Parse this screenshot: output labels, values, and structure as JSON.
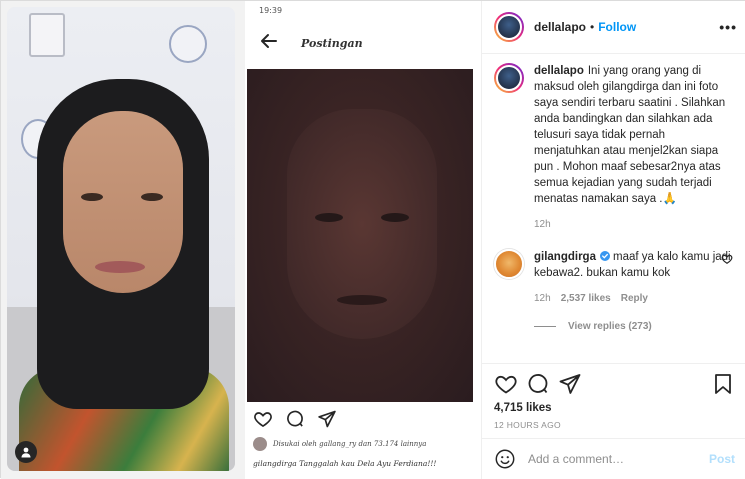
{
  "media": {
    "phone_status": "19:39",
    "phone_title": "Postingan",
    "phone_likes_text": "Disukai oleh gallang_ry dan 73.174 lainnya",
    "phone_caption": "gilangdirga Tanggalah kau Dela Ayu Ferdiana!!!"
  },
  "header": {
    "username": "dellalapo",
    "dot": "•",
    "follow_label": "Follow",
    "more_label": "•••"
  },
  "caption": {
    "username": "dellalapo",
    "text": "Ini yang orang yang di maksud oleh gilangdirga dan ini foto saya sendiri terbaru saatini . Silahkan anda bandingkan dan silahkan ada telusuri saya tidak pernah menjatuhkan atau menjel2kan siapa pun . Mohon maaf sebesar2nya atas semua kejadian yang sudah terjadi menatas namakan saya .🙏",
    "time": "12h"
  },
  "comment": {
    "username": "gilangdirga",
    "text": "maaf ya kalo kamu jadi kebawa2. bukan kamu kok",
    "time": "12h",
    "likes": "2,537 likes",
    "reply_label": "Reply",
    "view_replies": "View replies (273)"
  },
  "actions": {
    "likes": "4,715 likes",
    "time_ago": "12 HOURS AGO"
  },
  "add_comment": {
    "placeholder": "Add a comment…",
    "post_label": "Post"
  },
  "colors": {
    "link_blue": "#0095f6",
    "post_disabled": "#b2dffc",
    "muted": "#8e8e8e"
  },
  "icons": [
    "user-tag-icon",
    "back-arrow-icon",
    "heart-icon",
    "comment-icon",
    "share-icon",
    "save-icon",
    "emoji-icon",
    "verified-badge-icon",
    "more-options-icon"
  ]
}
